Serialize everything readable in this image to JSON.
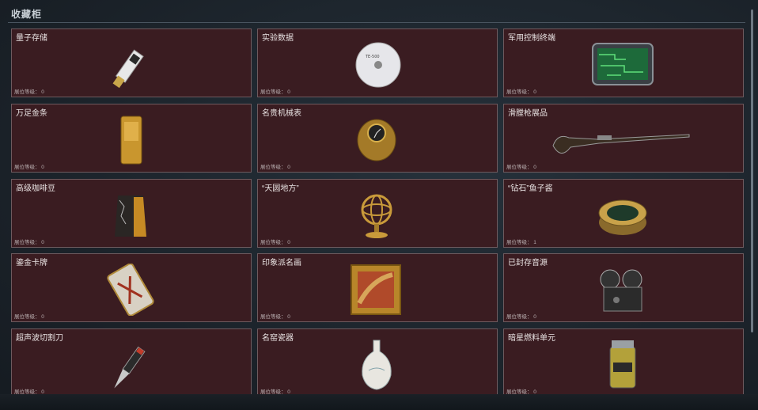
{
  "page": {
    "title": "收藏柜",
    "level_label": "展位等级："
  },
  "items": [
    {
      "name": "量子存储",
      "level": "0",
      "icon": "usb-drive-icon"
    },
    {
      "name": "实验数据",
      "level": "0",
      "icon": "disc-icon"
    },
    {
      "name": "军用控制终端",
      "level": "0",
      "icon": "circuit-terminal-icon"
    },
    {
      "name": "万足金条",
      "level": "0",
      "icon": "gold-bar-icon"
    },
    {
      "name": "名贵机械表",
      "level": "0",
      "icon": "watch-icon"
    },
    {
      "name": "滑膛枪展品",
      "level": "0",
      "icon": "musket-icon"
    },
    {
      "name": "高级咖啡豆",
      "level": "0",
      "icon": "coffee-bag-icon"
    },
    {
      "name": "“天圆地方”",
      "level": "0",
      "icon": "armillary-sphere-icon"
    },
    {
      "name": "“钻石”鱼子酱",
      "level": "1",
      "icon": "caviar-tin-icon"
    },
    {
      "name": "鎏金卡牌",
      "level": "0",
      "icon": "gilded-card-icon"
    },
    {
      "name": "印象派名画",
      "level": "0",
      "icon": "framed-painting-icon"
    },
    {
      "name": "已封存音源",
      "level": "0",
      "icon": "film-projector-icon"
    },
    {
      "name": "超声波切割刀",
      "level": "0",
      "icon": "cutting-knife-icon"
    },
    {
      "name": "名窑瓷器",
      "level": "0",
      "icon": "porcelain-vase-icon"
    },
    {
      "name": "暗星燃料单元",
      "level": "0",
      "icon": "fuel-canister-icon"
    }
  ]
}
